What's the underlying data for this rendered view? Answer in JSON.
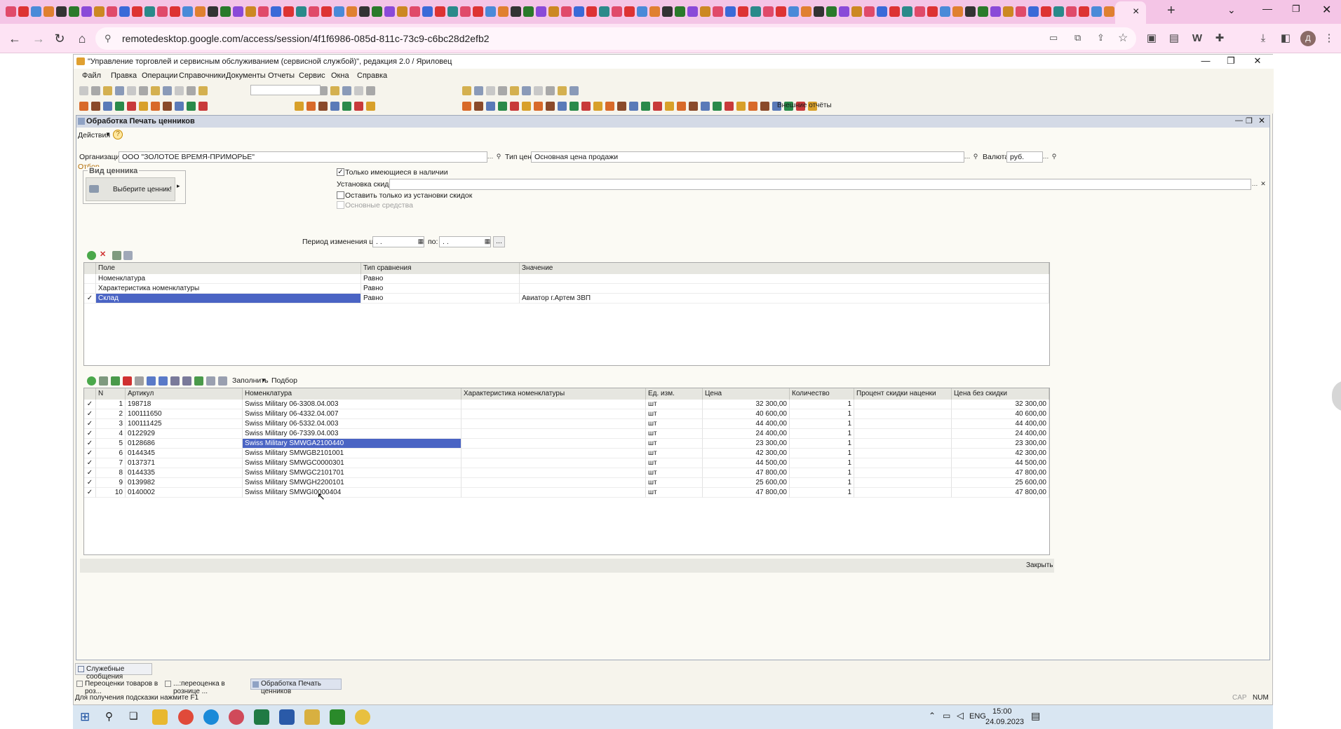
{
  "browser": {
    "url": "remotedesktop.google.com/access/session/4f1f6986-085d-811c-73c9-c6bc28d2efb2",
    "new_tab_symbol": "+",
    "close_tab_symbol": "×"
  },
  "app": {
    "title": "\"Управление торговлей и сервисным обслуживанием (сервисной службой)\", редакция 2.0 / Яриловец",
    "menu": [
      "Файл",
      "Правка",
      "Операции",
      "Справочники",
      "Документы",
      "Отчеты",
      "Сервис",
      "Окна",
      "Справка"
    ],
    "external_reports": "Внешние отчёты"
  },
  "form": {
    "title": "Обработка  Печать ценников",
    "actions": "Действия",
    "org_label": "Организация:",
    "org_value": "ООО \"ЗОЛОТОЕ ВРЕМЯ-ПРИМОРЬЕ\"",
    "price_type_label": "Тип цен:",
    "price_type_value": "Основная цена продажи",
    "currency_label": "Валюта:",
    "currency_value": "руб.",
    "filter_group": "Отбор",
    "tag_group": "Вид ценника",
    "tag_button": "Выберите ценник!",
    "only_in_stock": "Только имеющиеся в наличии",
    "discount_label": "Установка скидок:",
    "only_discounted": "Оставить только из установки скидок",
    "fixed_assets": "Основные средства",
    "period_label": "Период изменения цен с:",
    "period_to": "по:",
    "period_from_value": ". .",
    "period_to_value": ". .",
    "period_btn": "...",
    "fill_btn": "Заполнить",
    "select_btn": "Подбор",
    "close_btn": "Закрыть"
  },
  "filter_table": {
    "headers": [
      "Поле",
      "Тип сравнения",
      "Значение"
    ],
    "rows": [
      {
        "checked": "",
        "field": "Номенклатура",
        "cmp": "Равно",
        "value": ""
      },
      {
        "checked": "",
        "field": "Характеристика номенклатуры",
        "cmp": "Равно",
        "value": ""
      },
      {
        "checked": "✓",
        "field": "Склад",
        "cmp": "Равно",
        "value": "Авиатор  г.Артем ЗВП"
      }
    ]
  },
  "items_table": {
    "headers": [
      "N",
      "Артикул",
      "Номенклатура",
      "Характеристика номенклатуры",
      "Ед. изм.",
      "Цена",
      "Количество",
      "Процент скидки наценки",
      "Цена без скидки"
    ],
    "rows": [
      {
        "n": "1",
        "art": "198718",
        "name": "Swiss Military 06-3308.04.003",
        "char": "",
        "unit": "шт",
        "price": "32 300,00",
        "qty": "1",
        "disc": "",
        "full": "32 300,00"
      },
      {
        "n": "2",
        "art": "100111650",
        "name": "Swiss Military 06-4332.04.007",
        "char": "",
        "unit": "шт",
        "price": "40 600,00",
        "qty": "1",
        "disc": "",
        "full": "40 600,00"
      },
      {
        "n": "3",
        "art": "100111425",
        "name": "Swiss Military 06-5332.04.003",
        "char": "",
        "unit": "шт",
        "price": "44 400,00",
        "qty": "1",
        "disc": "",
        "full": "44 400,00"
      },
      {
        "n": "4",
        "art": "0122929",
        "name": "Swiss Military 06-7339.04.003",
        "char": "",
        "unit": "шт",
        "price": "24 400,00",
        "qty": "1",
        "disc": "",
        "full": "24 400,00"
      },
      {
        "n": "5",
        "art": "0128686",
        "name": "Swiss Military SMWGA2100440",
        "char": "",
        "unit": "шт",
        "price": "23 300,00",
        "qty": "1",
        "disc": "",
        "full": "23 300,00"
      },
      {
        "n": "6",
        "art": "0144345",
        "name": "Swiss Military SMWGB2101001",
        "char": "",
        "unit": "шт",
        "price": "42 300,00",
        "qty": "1",
        "disc": "",
        "full": "42 300,00"
      },
      {
        "n": "7",
        "art": "0137371",
        "name": "Swiss Military SMWGC0000301",
        "char": "",
        "unit": "шт",
        "price": "44 500,00",
        "qty": "1",
        "disc": "",
        "full": "44 500,00"
      },
      {
        "n": "8",
        "art": "0144335",
        "name": "Swiss Military SMWGC2101701",
        "char": "",
        "unit": "шт",
        "price": "47 800,00",
        "qty": "1",
        "disc": "",
        "full": "47 800,00"
      },
      {
        "n": "9",
        "art": "0139982",
        "name": "Swiss Military SMWGH2200101",
        "char": "",
        "unit": "шт",
        "price": "25 600,00",
        "qty": "1",
        "disc": "",
        "full": "25 600,00"
      },
      {
        "n": "10",
        "art": "0140002",
        "name": "Swiss Military SMWGI0000404",
        "char": "",
        "unit": "шт",
        "price": "47 800,00",
        "qty": "1",
        "disc": "",
        "full": "47 800,00"
      }
    ]
  },
  "service_messages": "Служебные сообщения",
  "windows_bar": [
    "Переоценки товаров в роз...",
    "...:переоценка в рознице ...",
    "Обработка  Печать ценников"
  ],
  "status": {
    "hint": "Для получения подсказки нажмите F1",
    "cap": "CAP",
    "num": "NUM"
  },
  "taskbar": {
    "lang": "ENG",
    "time": "15:00",
    "date": "24.09.2023"
  }
}
